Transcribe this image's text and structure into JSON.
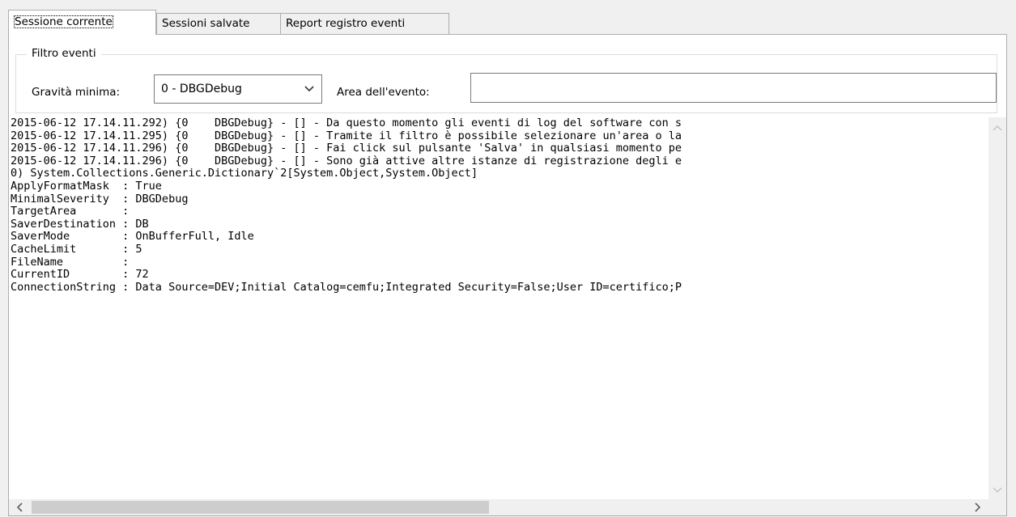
{
  "tabs": [
    {
      "label": "Sessione corrente"
    },
    {
      "label": "Sessioni salvate"
    },
    {
      "label": "Report registro eventi"
    }
  ],
  "filter": {
    "group_title": "Filtro eventi",
    "severity_label": "Gravità minima:",
    "severity_value": "0 - DBGDebug",
    "area_label": "Area dell'evento:",
    "area_value": ""
  },
  "log": {
    "lines": [
      "2015-06-12 17.14.11.292) {0    DBGDebug} - [] - Da questo momento gli eventi di log del software con s",
      "2015-06-12 17.14.11.295) {0    DBGDebug} - [] - Tramite il filtro è possibile selezionare un'area o la",
      "2015-06-12 17.14.11.296) {0    DBGDebug} - [] - Fai click sul pulsante 'Salva' in qualsiasi momento pe",
      "2015-06-12 17.14.11.296) {0    DBGDebug} - [] - Sono già attive altre istanze di registrazione degli e",
      "0) System.Collections.Generic.Dictionary`2[System.Object,System.Object]",
      "ApplyFormatMask  : True",
      "MinimalSeverity  : DBGDebug",
      "TargetArea       :",
      "SaverDestination : DB",
      "SaverMode        : OnBufferFull, Idle",
      "CacheLimit       : 5",
      "FileName         :",
      "CurrentID        : 72",
      "ConnectionString : Data Source=DEV;Initial Catalog=cemfu;Integrated Security=False;User ID=certifico;P"
    ]
  },
  "scroll": {
    "horizontal_position_fraction": 0.0,
    "horizontal_visible_fraction": 0.49
  }
}
